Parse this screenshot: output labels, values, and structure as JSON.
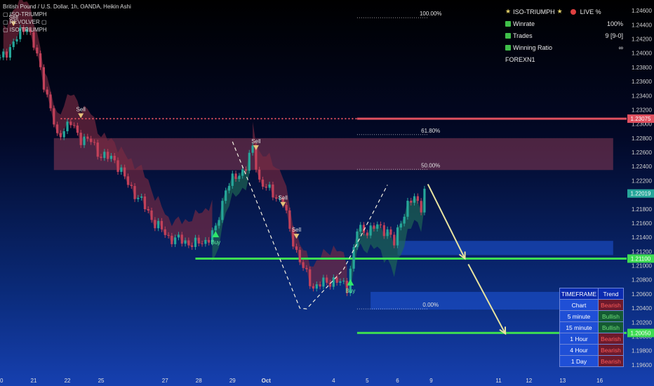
{
  "legend": {
    "symbol_line": "British Pound / U.S. Dollar, 1h, OANDA, Heikin Ashi",
    "indicators": [
      "ISO-TRIUMPH",
      "REVOLVER",
      "ISO-TRIUMPH"
    ]
  },
  "stats": {
    "title": "ISO-TRIUMPH",
    "live": "LIVE %",
    "rows": [
      {
        "label": "Winrate",
        "value": "100%"
      },
      {
        "label": "Trades",
        "value": "9 [9-0]"
      },
      {
        "label": "Winning Ratio",
        "value": "∞"
      }
    ],
    "footer": "FOREXN1"
  },
  "timeframe_table": {
    "headers": [
      "TIMEFRAME",
      "Trend"
    ],
    "rows": [
      {
        "tf": "Chart",
        "trend": "Bearish"
      },
      {
        "tf": "5 minute",
        "trend": "Bullish"
      },
      {
        "tf": "15 minute",
        "trend": "Bullish"
      },
      {
        "tf": "1 Hour",
        "trend": "Bearish"
      },
      {
        "tf": "4 Hour",
        "trend": "Bearish"
      },
      {
        "tf": "1 Day",
        "trend": "Bearish"
      }
    ]
  },
  "colors": {
    "up": "#26a69a",
    "down": "#c2415a",
    "green_line": "#3ddc52",
    "red_line": "#e0505f",
    "zone_red": "#8a3a55",
    "zone_blue": "#1f55d8",
    "band_red": "#7a2a40",
    "band_green": "#1f6a55",
    "arrow": "#e8e4a0",
    "signal_sell": "#e6c27a",
    "signal_buy": "#2ee86a"
  },
  "chart_data": {
    "type": "candlestick",
    "ylim": [
      1.1945,
      1.2475
    ],
    "y_ticks": [
      1.246,
      1.244,
      1.242,
      1.24,
      1.238,
      1.236,
      1.234,
      1.232,
      1.23,
      1.228,
      1.226,
      1.224,
      1.222,
      1.22,
      1.218,
      1.216,
      1.214,
      1.212,
      1.21,
      1.208,
      1.206,
      1.204,
      1.202,
      1.2,
      1.198,
      1.196
    ],
    "x_index_range": [
      0,
      186
    ],
    "x_ticks": [
      {
        "label": "20",
        "i": 0
      },
      {
        "label": "21",
        "i": 10
      },
      {
        "label": "22",
        "i": 20
      },
      {
        "label": "25",
        "i": 30
      },
      {
        "label": "27",
        "i": 49
      },
      {
        "label": "28",
        "i": 59
      },
      {
        "label": "29",
        "i": 69
      },
      {
        "label": "Oct",
        "i": 79
      },
      {
        "label": "4",
        "i": 99
      },
      {
        "label": "5",
        "i": 109
      },
      {
        "label": "6",
        "i": 118
      },
      {
        "label": "9",
        "i": 128
      },
      {
        "label": "11",
        "i": 148
      },
      {
        "label": "12",
        "i": 157
      },
      {
        "label": "13",
        "i": 167
      },
      {
        "label": "16",
        "i": 178
      }
    ],
    "price_labels": [
      {
        "text": "1.23075",
        "value": 1.23075,
        "color": "#e0505f"
      },
      {
        "text": "1.22019",
        "value": 1.22019,
        "color": "#26a69a"
      },
      {
        "text": "1.21100",
        "value": 1.211,
        "color": "#3ddc52"
      },
      {
        "text": "1.20050",
        "value": 1.2005,
        "color": "#3ddc52"
      }
    ],
    "fib_levels": [
      {
        "label": "100.00%",
        "value": 1.245
      },
      {
        "label": "61.80%",
        "value": 1.2285
      },
      {
        "label": "50.00%",
        "value": 1.2236
      },
      {
        "label": "0.00%",
        "value": 1.2039
      }
    ],
    "horizontal_lines": [
      {
        "name": "green-1",
        "value": 1.211,
        "i_from": 58,
        "i_to": 186,
        "color": "#3ddc52"
      },
      {
        "name": "green-2",
        "value": 1.2005,
        "i_from": 106,
        "i_to": 186,
        "color": "#3ddc52"
      },
      {
        "name": "red-solid",
        "value": 1.23075,
        "i_from": 106,
        "i_to": 186,
        "color": "#e0505f"
      },
      {
        "name": "red-dotted",
        "value": 1.23075,
        "i_from": 18,
        "i_to": 106,
        "color": "#e0505f"
      }
    ],
    "zones": [
      {
        "name": "supply-zone",
        "top": 1.228,
        "bottom": 1.2235,
        "i_from": 16,
        "i_to": 182,
        "color": "zone_red"
      },
      {
        "name": "demand-zone-1",
        "top": 1.2135,
        "bottom": 1.2115,
        "i_from": 118,
        "i_to": 182,
        "color": "zone_blue"
      },
      {
        "name": "demand-zone-2",
        "top": 1.2063,
        "bottom": 1.2038,
        "i_from": 110,
        "i_to": 182,
        "color": "zone_blue"
      }
    ],
    "signals": [
      {
        "type": "sell",
        "label": "Sell",
        "i": 4,
        "value": 1.2445
      },
      {
        "type": "sell",
        "label": "Sell",
        "i": 24,
        "value": 1.2315
      },
      {
        "type": "sell",
        "label": "Sell",
        "i": 76,
        "value": 1.227
      },
      {
        "type": "sell",
        "label": "Sell",
        "i": 84,
        "value": 1.219
      },
      {
        "type": "sell",
        "label": "Sell",
        "i": 88,
        "value": 1.2145
      },
      {
        "type": "buy",
        "label": "Buy",
        "i": 64,
        "value": 1.214
      },
      {
        "type": "buy",
        "label": "Buy",
        "i": 104,
        "value": 1.2072
      }
    ],
    "dashed_path": [
      [
        69,
        1.2275
      ],
      [
        89,
        1.204
      ],
      [
        91,
        1.2039
      ],
      [
        102,
        1.2095
      ],
      [
        115,
        1.2214
      ]
    ],
    "projection_arrows": [
      {
        "from": [
          127,
          1.2215
        ],
        "to": [
          138,
          1.211
        ]
      },
      {
        "from": [
          139,
          1.2102
        ],
        "to": [
          150,
          1.2004
        ]
      }
    ],
    "series": [
      {
        "name": "GBPUSD",
        "ohlc_anchors": [
          [
            0,
            1.239
          ],
          [
            4,
            1.2415
          ],
          [
            8,
            1.244
          ],
          [
            11,
            1.2395
          ],
          [
            14,
            1.234
          ],
          [
            17,
            1.228
          ],
          [
            19,
            1.2295
          ],
          [
            21,
            1.23
          ],
          [
            24,
            1.228
          ],
          [
            27,
            1.2275
          ],
          [
            30,
            1.2255
          ],
          [
            34,
            1.225
          ],
          [
            38,
            1.2215
          ],
          [
            42,
            1.219
          ],
          [
            46,
            1.216
          ],
          [
            50,
            1.214
          ],
          [
            54,
            1.2135
          ],
          [
            58,
            1.213
          ],
          [
            61,
            1.2135
          ],
          [
            64,
            1.215
          ],
          [
            67,
            1.221
          ],
          [
            70,
            1.2225
          ],
          [
            73,
            1.224
          ],
          [
            75,
            1.2265
          ],
          [
            77,
            1.222
          ],
          [
            80,
            1.2205
          ],
          [
            84,
            1.219
          ],
          [
            86,
            1.215
          ],
          [
            88,
            1.212
          ],
          [
            90,
            1.2095
          ],
          [
            93,
            1.207
          ],
          [
            96,
            1.2075
          ],
          [
            99,
            1.208
          ],
          [
            103,
            1.207
          ],
          [
            106,
            1.215
          ],
          [
            109,
            1.215
          ],
          [
            112,
            1.2155
          ],
          [
            115,
            1.215
          ],
          [
            117,
            1.213
          ],
          [
            119,
            1.2165
          ],
          [
            121,
            1.2185
          ],
          [
            123,
            1.2195
          ],
          [
            125,
            1.2185
          ],
          [
            126,
            1.2205
          ]
        ]
      }
    ]
  }
}
